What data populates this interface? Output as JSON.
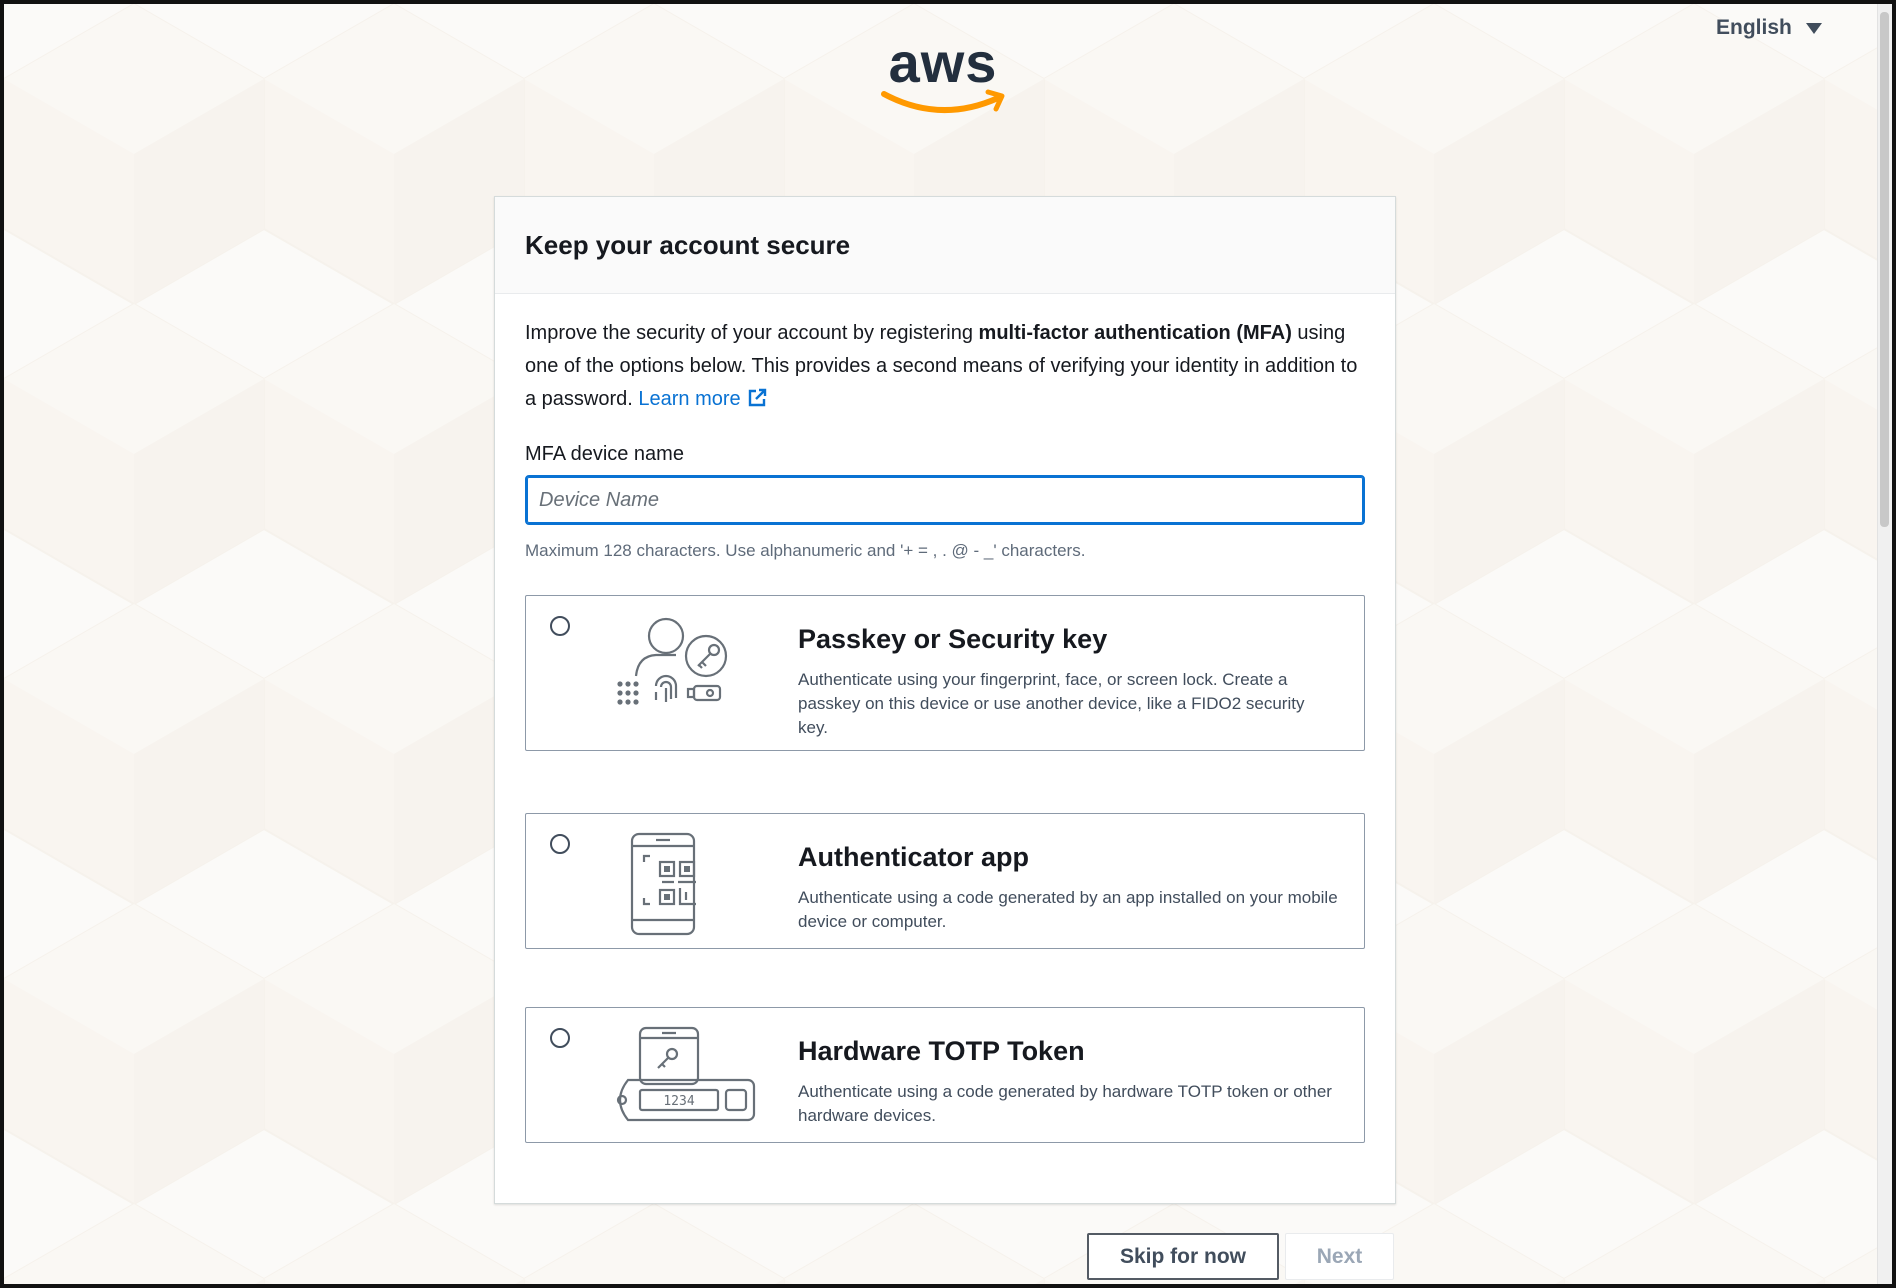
{
  "header": {
    "language": "English",
    "logo_text": "aws",
    "brand_color": "#ff9900"
  },
  "card": {
    "title": "Keep your account secure",
    "intro_before": "Improve the security of your account by registering ",
    "intro_bold": "multi-factor authentication (MFA)",
    "intro_after": " using one of the options below. This provides a second means of verifying your identity in addition to a password. ",
    "learn_more": "Learn more",
    "device_name_label": "MFA device name",
    "device_name_value": "",
    "device_name_placeholder": "Device Name",
    "device_name_hint": "Maximum 128 characters. Use alphanumeric and '+ = , . @ - _' characters."
  },
  "options": [
    {
      "title": "Passkey or Security key",
      "description": "Authenticate using your fingerprint, face, or screen lock. Create a passkey on this device or use another device, like a FIDO2 security key.",
      "icon": "passkey-icon",
      "selected": false
    },
    {
      "title": "Authenticator app",
      "description": "Authenticate using a code generated by an app installed on your mobile device or computer.",
      "icon": "authenticator-app-icon",
      "selected": false
    },
    {
      "title": "Hardware TOTP Token",
      "description": "Authenticate using a code generated by hardware TOTP token or other hardware devices.",
      "icon": "hardware-token-icon",
      "token_display": "1234",
      "selected": false
    }
  ],
  "actions": {
    "skip_label": "Skip for now",
    "next_label": "Next"
  },
  "colors": {
    "link": "#0972d3",
    "text": "#16191f",
    "input_focus": "#0972d3"
  }
}
